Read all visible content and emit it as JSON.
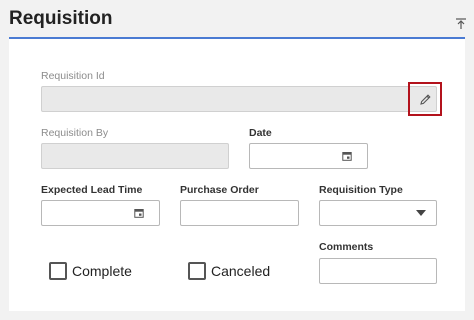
{
  "header": {
    "title": "Requisition",
    "collapse_icon": "collapse-up-icon"
  },
  "form": {
    "requisition_id": {
      "label": "Requisition Id",
      "value": "",
      "edit_icon": "pencil-icon"
    },
    "requisition_by": {
      "label": "Requisition By",
      "value": ""
    },
    "date": {
      "label": "Date",
      "value": "",
      "icon": "calendar-icon"
    },
    "expected_lead_time": {
      "label": "Expected Lead Time",
      "value": "",
      "icon": "calendar-icon"
    },
    "purchase_order": {
      "label": "Purchase Order",
      "value": ""
    },
    "requisition_type": {
      "label": "Requisition Type",
      "value": "",
      "icon": "chevron-down-icon"
    },
    "comments": {
      "label": "Comments",
      "value": ""
    },
    "complete": {
      "label": "Complete",
      "checked": false
    },
    "canceled": {
      "label": "Canceled",
      "checked": false
    }
  },
  "colors": {
    "accent_line": "#4a7bd3",
    "edit_highlight": "#b3121c",
    "disabled_field": "#e9e9e9"
  }
}
